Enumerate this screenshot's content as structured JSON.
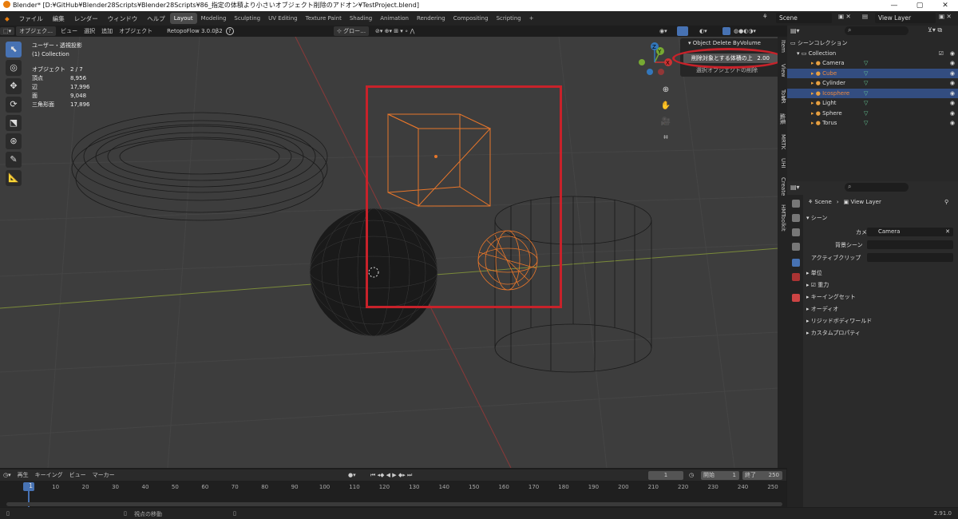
{
  "title": "Blender* [D:¥GitHub¥Blender28Scripts¥Blender28Scripts¥86_指定の体積より小さいオブジェクト削除のアドオン¥TestProject.blend]",
  "window_buttons": [
    "—",
    "▢",
    "✕"
  ],
  "menu": [
    "ファイル",
    "編集",
    "レンダー",
    "ウィンドウ",
    "ヘルプ"
  ],
  "workspaces": [
    "Layout",
    "Modeling",
    "Sculpting",
    "UV Editing",
    "Texture Paint",
    "Shading",
    "Animation",
    "Rendering",
    "Compositing",
    "Scripting"
  ],
  "add_tab": "+",
  "scene_name": "Scene",
  "view_layer": "View Layer",
  "vp_header": {
    "mode": "オブジェク…",
    "view": "ビュー",
    "select": "選択",
    "add": "追加",
    "object": "オブジェクト",
    "retopo": "RetopoFlow 3.0.0β2",
    "help": "?",
    "orientation": "グロー…"
  },
  "overlay": {
    "view_name": "ユーザー・透視投影",
    "collection": "(1) Collection"
  },
  "stats": [
    {
      "k": "オブジェクト",
      "v": "2 / 7"
    },
    {
      "k": "頂点",
      "v": "8,956"
    },
    {
      "k": "辺",
      "v": "17,996"
    },
    {
      "k": "面",
      "v": "9,048"
    },
    {
      "k": "三角形面",
      "v": "17,896"
    }
  ],
  "popup": {
    "title": "Object Delete ByVolume",
    "field_label": "削除対象とする体積の上",
    "field_value": "2.00",
    "button": "選択オブジェクトの削除"
  },
  "gizmo": {
    "x": "X",
    "y": "Y",
    "z": "Z"
  },
  "side_tabs": [
    "Item",
    "View",
    "Tool",
    "VR",
    "編集",
    "MRTK",
    "UHI",
    "Create",
    "HMToolkit"
  ],
  "outliner": {
    "root": "シーンコレクション",
    "collection": "Collection",
    "items": [
      {
        "name": "Camera",
        "color": "#dddddd",
        "selected": false,
        "icon": "camera-icon"
      },
      {
        "name": "Cube",
        "color": "#f08a3c",
        "selected": true,
        "icon": "mesh-icon"
      },
      {
        "name": "Cylinder",
        "color": "#dddddd",
        "selected": false,
        "icon": "mesh-icon"
      },
      {
        "name": "Icosphere",
        "color": "#f08a3c",
        "selected": true,
        "icon": "mesh-icon"
      },
      {
        "name": "Light",
        "color": "#dddddd",
        "selected": false,
        "icon": "light-icon"
      },
      {
        "name": "Sphere",
        "color": "#dddddd",
        "selected": false,
        "icon": "mesh-icon"
      },
      {
        "name": "Torus",
        "color": "#dddddd",
        "selected": false,
        "icon": "mesh-icon"
      }
    ]
  },
  "properties": {
    "scene": "Scene",
    "view_layer": "View Layer",
    "panel_scene": "シーン",
    "camera_label": "カメラ",
    "camera_value": "Camera",
    "bg_scene_label": "背景シーン",
    "active_clip_label": "アクティブクリップ",
    "sections": [
      "単位",
      "重力",
      "キーイングセット",
      "オーディオ",
      "リジッドボディワールド",
      "カスタムプロパティ"
    ]
  },
  "timeline": {
    "menu": [
      "再生",
      "キーイング",
      "ビュー",
      "マーカー"
    ],
    "current_frame": "1",
    "start_label": "開始",
    "start": "1",
    "end_label": "終了",
    "end": "250",
    "frames": [
      "1",
      "10",
      "20",
      "30",
      "40",
      "50",
      "60",
      "70",
      "80",
      "90",
      "100",
      "110",
      "120",
      "130",
      "140",
      "150",
      "160",
      "170",
      "180",
      "190",
      "200",
      "210",
      "220",
      "230",
      "240",
      "250"
    ]
  },
  "status": {
    "hint": "視点の移動",
    "version": "2.91.0"
  },
  "colors": {
    "accent": "#4772b3",
    "selection": "#f08a3c",
    "annotation": "#c8222a"
  }
}
